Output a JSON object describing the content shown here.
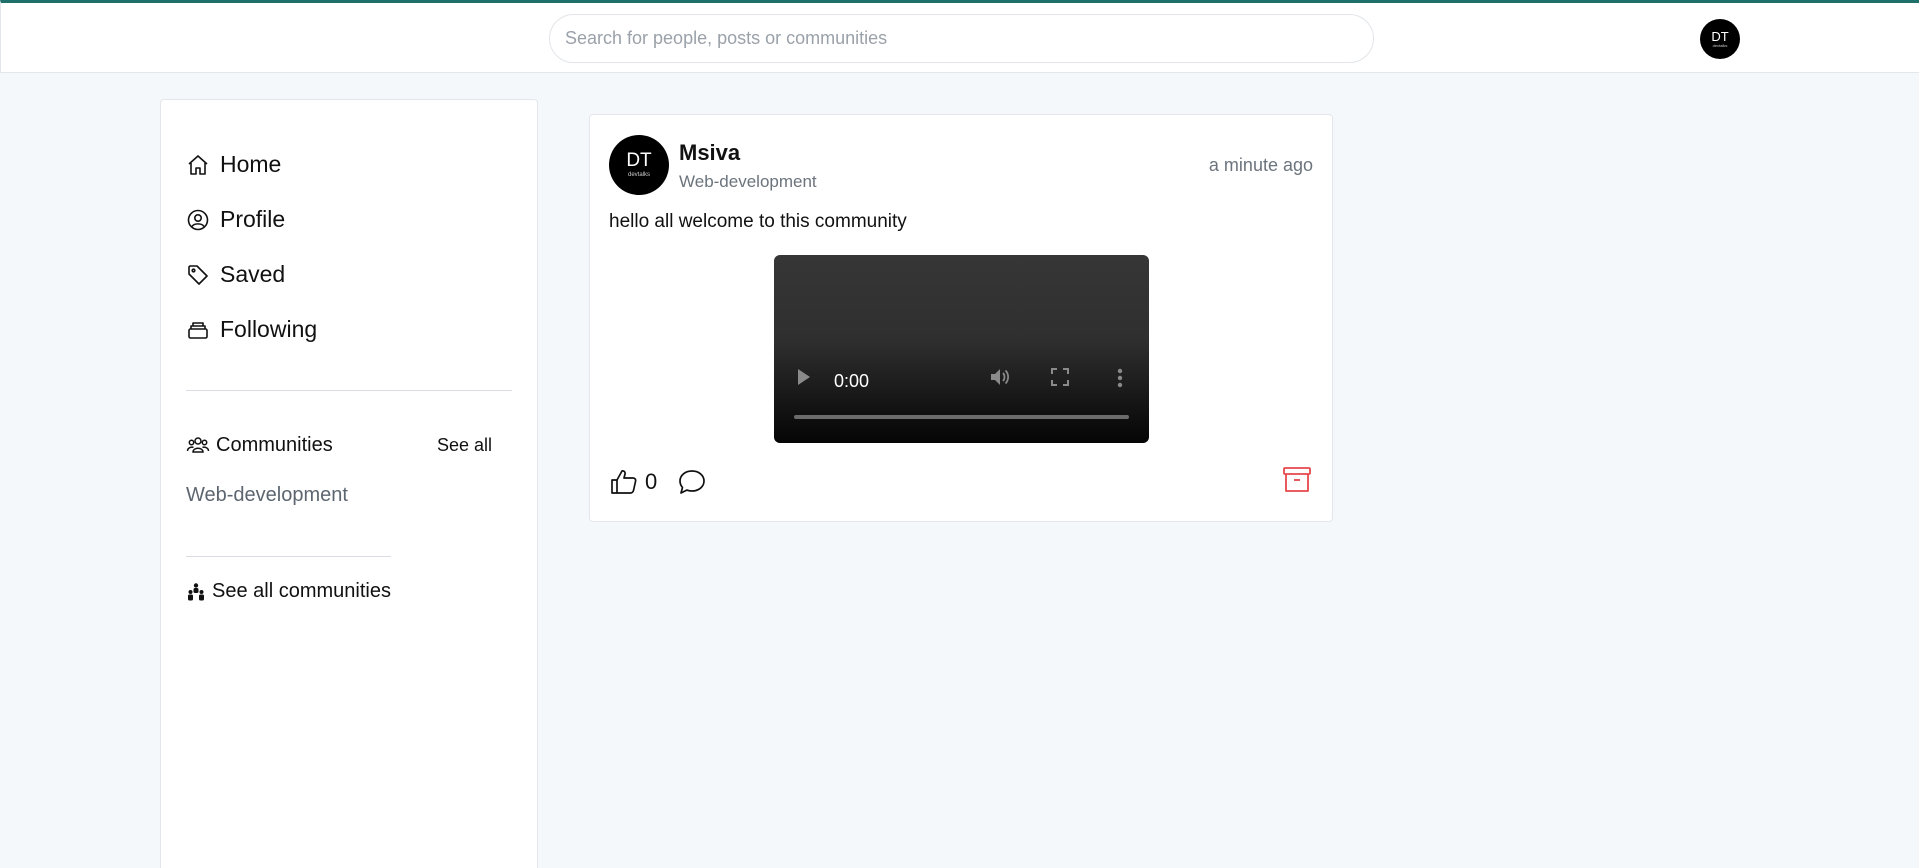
{
  "header": {
    "search_placeholder": "Search for people, posts or communities",
    "avatar_initials": "DT",
    "avatar_subtext": "devtalks"
  },
  "sidebar": {
    "nav": [
      {
        "label": "Home",
        "icon": "home-icon"
      },
      {
        "label": "Profile",
        "icon": "user-circle-icon"
      },
      {
        "label": "Saved",
        "icon": "tag-icon"
      },
      {
        "label": "Following",
        "icon": "archive-icon"
      }
    ],
    "communities_title": "Communities",
    "see_all_label": "See all",
    "communities": [
      "Web-development"
    ],
    "see_all_communities_label": "See all communities"
  },
  "post": {
    "author": "Msiva",
    "community": "Web-development",
    "time": "a minute ago",
    "text": "hello all welcome to this community",
    "avatar_initials": "DT",
    "avatar_subtext": "devtalks",
    "video": {
      "current_time": "0:00",
      "progress": 0
    },
    "like_count": "0"
  },
  "colors": {
    "accent_border": "#1f6f6a",
    "delete": "#e5484d",
    "background": "#f5f8fb"
  }
}
